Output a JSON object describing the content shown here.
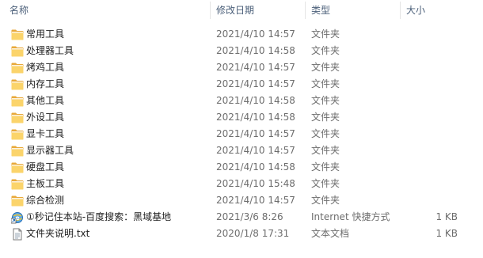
{
  "columns": {
    "name": "名称",
    "date": "修改日期",
    "type": "类型",
    "size": "大小"
  },
  "rows": [
    {
      "name": "常用工具",
      "date": "2021/4/10 14:57",
      "type": "文件夹",
      "size": "",
      "icon": "folder-icon"
    },
    {
      "name": "处理器工具",
      "date": "2021/4/10 14:58",
      "type": "文件夹",
      "size": "",
      "icon": "folder-icon"
    },
    {
      "name": "烤鸡工具",
      "date": "2021/4/10 14:57",
      "type": "文件夹",
      "size": "",
      "icon": "folder-icon"
    },
    {
      "name": "内存工具",
      "date": "2021/4/10 14:57",
      "type": "文件夹",
      "size": "",
      "icon": "folder-icon"
    },
    {
      "name": "其他工具",
      "date": "2021/4/10 14:58",
      "type": "文件夹",
      "size": "",
      "icon": "folder-icon"
    },
    {
      "name": "外设工具",
      "date": "2021/4/10 14:58",
      "type": "文件夹",
      "size": "",
      "icon": "folder-icon"
    },
    {
      "name": "显卡工具",
      "date": "2021/4/10 14:57",
      "type": "文件夹",
      "size": "",
      "icon": "folder-icon"
    },
    {
      "name": "显示器工具",
      "date": "2021/4/10 14:57",
      "type": "文件夹",
      "size": "",
      "icon": "folder-icon"
    },
    {
      "name": "硬盘工具",
      "date": "2021/4/10 14:58",
      "type": "文件夹",
      "size": "",
      "icon": "folder-icon"
    },
    {
      "name": "主板工具",
      "date": "2021/4/10 15:48",
      "type": "文件夹",
      "size": "",
      "icon": "folder-icon"
    },
    {
      "name": "综合检测",
      "date": "2021/4/10 14:57",
      "type": "文件夹",
      "size": "",
      "icon": "folder-icon"
    },
    {
      "name": "①秒记住本站-百度搜索：黑域基地",
      "date": "2021/3/6 8:26",
      "type": "Internet 快捷方式",
      "size": "1 KB",
      "icon": "internet-shortcut-icon"
    },
    {
      "name": "文件夹说明.txt",
      "date": "2020/1/8 17:31",
      "type": "文本文档",
      "size": "1 KB",
      "icon": "text-document-icon"
    }
  ],
  "colors": {
    "folder_body": "#f5c243",
    "folder_front": "#f8d775",
    "header_text": "#4c607a"
  }
}
